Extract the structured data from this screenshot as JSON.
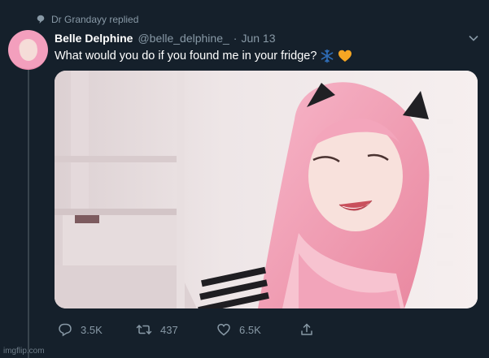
{
  "context": {
    "text": "Dr Grandayy replied",
    "icon": "comment-icon"
  },
  "tweet": {
    "author_name": "Belle Delphine",
    "handle": "@belle_delphine_",
    "separator": "·",
    "date": "Jun 13",
    "text": "What would you do if you found me in your fridge?",
    "emojis": [
      "snowflake-icon",
      "orange-heart-icon"
    ],
    "menu_icon": "chevron-down-icon"
  },
  "actions": {
    "replies": "3.5K",
    "retweets": "437",
    "likes": "6.5K",
    "share_icon": "share-icon"
  },
  "watermark": "imgflip.com",
  "colors": {
    "background": "#15202b",
    "secondary_text": "#8899a6",
    "thread_line": "#38444d",
    "snowflake": "#2f6db7",
    "heart": "#f5a623"
  }
}
